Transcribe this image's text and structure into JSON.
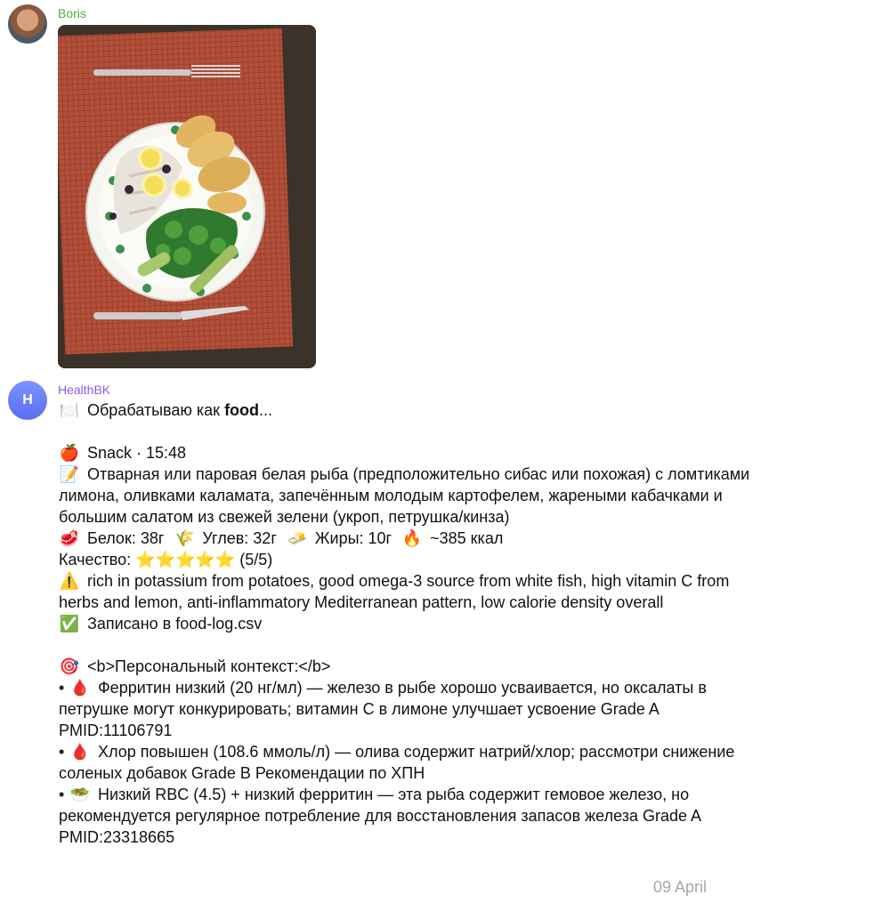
{
  "chat": {
    "date": "09 April"
  },
  "messages": [
    {
      "sender": "Boris",
      "avatar": "user-photo"
    },
    {
      "sender": "HealthBK",
      "avatar_letter": "H",
      "processing": {
        "icon": "plate-icon",
        "prefix": "Обрабатываю как ",
        "bold": "food",
        "suffix": "..."
      },
      "meal": {
        "icon": "apple-icon",
        "type_time": "Snack · 15:48",
        "desc_icon": "memo-icon",
        "description": "Отварная или паровая белая рыба (предположительно сибас или похожая) с ломтиками лимона, оливками каламата, запечённым молодым картофелем, жареными кабачками и большим салатом из свежей зелени (укроп, петрушка/кинза)",
        "macros": [
          {
            "icon": "meat-icon",
            "label": "Белок: 38г"
          },
          {
            "icon": "wheat-icon",
            "label": "Углев: 32г"
          },
          {
            "icon": "butter-icon",
            "label": "Жиры: 10г"
          },
          {
            "icon": "fire-icon",
            "label": "~385 ккал"
          }
        ],
        "quality_label": "Качество:",
        "quality_score": "(5/5)",
        "stars_filled": 5,
        "stars_total": 5,
        "note_icon": "warning-icon",
        "note": "rich in potassium from potatoes, good omega-3 source from white fish, high vitamin C from herbs and lemon, anti-inflammatory Mediterranean pattern, low calorie density overall",
        "saved_icon": "check-icon",
        "saved": "Записано в food-log.csv"
      },
      "context": {
        "icon": "target-icon",
        "title": "<b>Персональный контекст:</b>",
        "bullets": [
          {
            "icon": "blood-drop-icon",
            "text": "Ферритин низкий (20 нг/мл) — железо в рыбе хорошо усваивается, но оксалаты в петрушке могут конкурировать; витамин С в лимоне улучшает усвоение Grade A PMID:11106791"
          },
          {
            "icon": "blood-drop-icon",
            "text": "Хлор повышен (108.6 ммоль/л) — олива содержит натрий/хлор; рассмотри снижение соленых добавок Grade B Рекомендации по ХПН"
          },
          {
            "icon": "salad-icon",
            "text": "Низкий RBC (4.5) + низкий ферритин — эта рыба содержит гемовое железо, но рекомендуется регулярное потребление для восстановления запасов железа Grade A PMID:23318665"
          }
        ]
      }
    }
  ]
}
